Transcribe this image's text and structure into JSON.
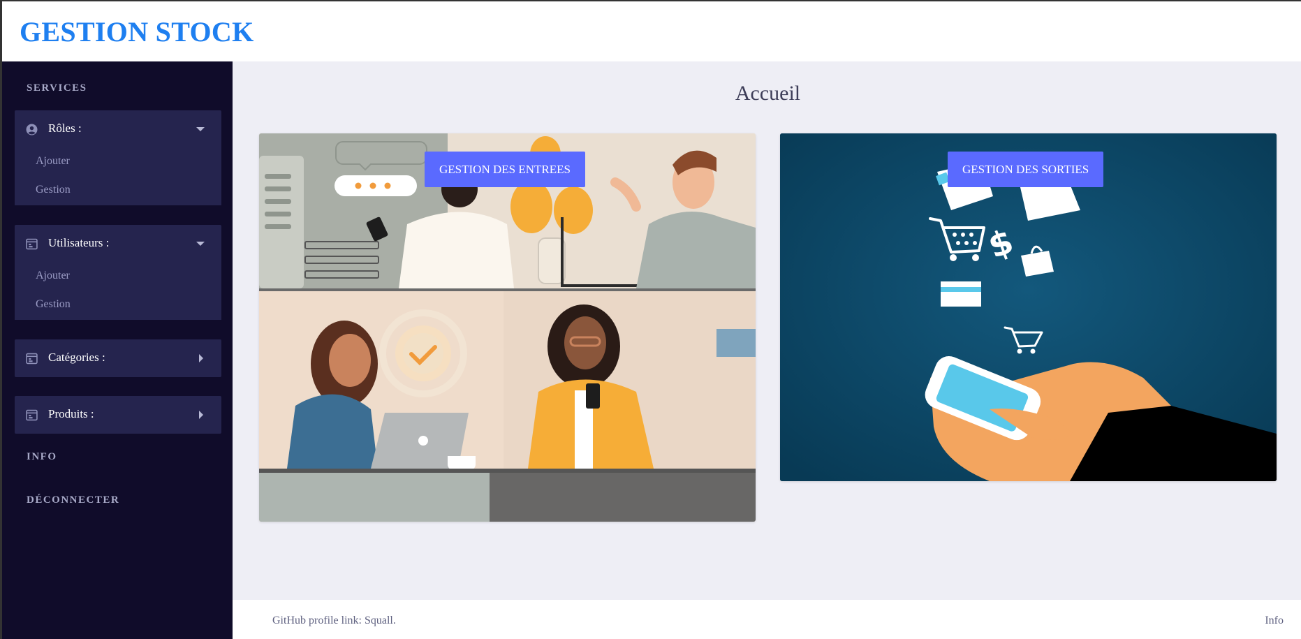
{
  "header": {
    "brand": "GESTION STOCK"
  },
  "sidebar": {
    "section_services": "SERVICES",
    "groups": [
      {
        "label": "Rôles :",
        "icon": "user-circle-icon",
        "expanded": true,
        "items": [
          "Ajouter",
          "Gestion"
        ]
      },
      {
        "label": "Utilisateurs :",
        "icon": "calendar-icon",
        "expanded": true,
        "items": [
          "Ajouter",
          "Gestion"
        ]
      },
      {
        "label": "Catégories :",
        "icon": "calendar-icon",
        "expanded": false,
        "items": []
      },
      {
        "label": "Produits :",
        "icon": "calendar-icon",
        "expanded": false,
        "items": []
      }
    ],
    "section_info": "INFO",
    "section_logout": "DÉCONNECTER"
  },
  "main": {
    "title": "Accueil",
    "cards": [
      {
        "button": "GESTION DES ENTREES",
        "image": "office-workers-illustration"
      },
      {
        "button": "GESTION DES SORTIES",
        "image": "mobile-shopping-illustration"
      }
    ]
  },
  "footer": {
    "link_text": "GitHub profile link: Squall.",
    "info": "Info"
  },
  "colors": {
    "brand": "#1e7ff0",
    "sidebar_bg": "#100c2a",
    "sidebar_group_bg": "#25244e",
    "button": "#5a6aff",
    "page_bg": "#eeeef5"
  }
}
